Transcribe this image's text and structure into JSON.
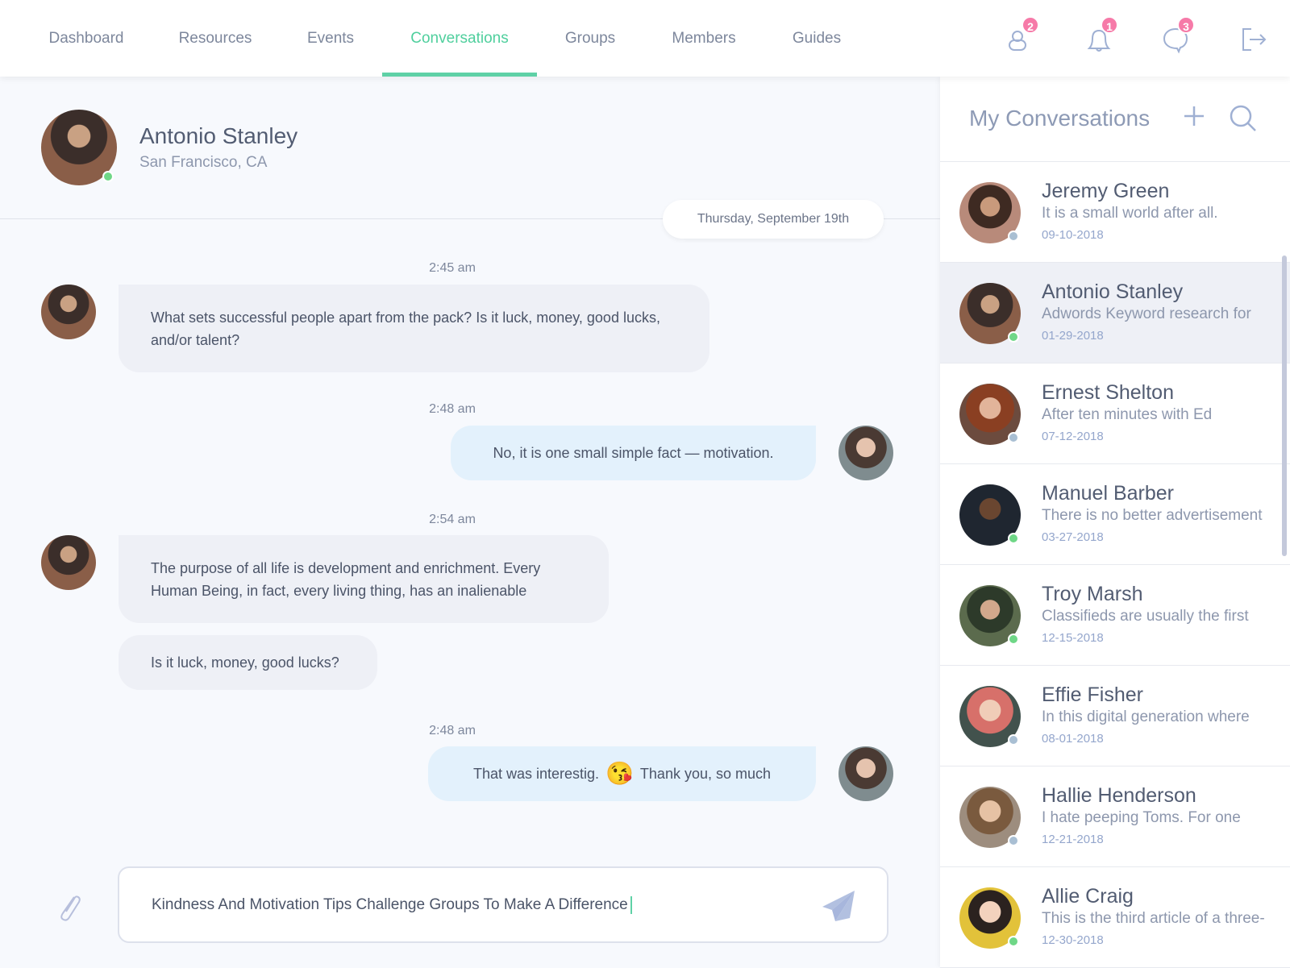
{
  "nav": {
    "tabs": [
      {
        "label": "Dashboard"
      },
      {
        "label": "Resources"
      },
      {
        "label": "Events"
      },
      {
        "label": "Conversations",
        "active": true
      },
      {
        "label": "Groups"
      },
      {
        "label": "Members"
      },
      {
        "label": "Guides"
      }
    ],
    "icons": [
      {
        "icon": "user-icon",
        "badge": "2"
      },
      {
        "icon": "bell-icon",
        "badge": "1"
      },
      {
        "icon": "chat-bubble-icon",
        "badge": "3"
      },
      {
        "icon": "logout-icon"
      }
    ]
  },
  "colors": {
    "accent": "#5fd1a6",
    "badge": "#f67aa8",
    "online": "#6fd787",
    "offline": "#a9bfd3"
  },
  "chat": {
    "contact": {
      "name": "Antonio Stanley",
      "location": "San Francisco, CA",
      "status": "online"
    },
    "date": "Thursday, September 19th",
    "messages": [
      {
        "time": "2:45 am",
        "from": "them",
        "texts": [
          "What sets successful people apart from the pack? Is it luck, money, good lucks, and/or talent?"
        ]
      },
      {
        "time": "2:48 am",
        "from": "me",
        "texts": [
          "No, it is one small simple fact — motivation."
        ]
      },
      {
        "time": "2:54 am",
        "from": "them",
        "texts": [
          "The purpose of all life is development and enrichment. Every Human Being, in fact, every living thing, has an inalienable",
          "Is it luck, money, good lucks?"
        ]
      },
      {
        "time": "2:48 am",
        "from": "me",
        "texts": [
          "That was interestig.",
          "Thank you, so much"
        ],
        "emoji": "😘"
      }
    ],
    "input": {
      "value": "Kindness And Motivation Tips Challenge Groups To Make A Difference"
    }
  },
  "sidebar": {
    "title": "My Conversations",
    "items": [
      {
        "name": "Jeremy Green",
        "preview": "It is a small world after all.",
        "date": "09-10-2018",
        "status": "offline"
      },
      {
        "name": "Antonio Stanley",
        "preview": "Adwords Keyword research for",
        "date": "01-29-2018",
        "status": "online",
        "selected": true
      },
      {
        "name": "Ernest Shelton",
        "preview": "After ten minutes with Ed",
        "date": "07-12-2018",
        "status": "offline"
      },
      {
        "name": "Manuel Barber",
        "preview": "There is no better advertisement",
        "date": "03-27-2018",
        "status": "online"
      },
      {
        "name": "Troy Marsh",
        "preview": "Classifieds are usually the first",
        "date": "12-15-2018",
        "status": "online"
      },
      {
        "name": "Effie Fisher",
        "preview": "In this digital generation where",
        "date": "08-01-2018",
        "status": "offline"
      },
      {
        "name": "Hallie Henderson",
        "preview": "I hate peeping Toms. For one",
        "date": "12-21-2018",
        "status": "offline"
      },
      {
        "name": "Allie Craig",
        "preview": "This is the third article of a three-",
        "date": "12-30-2018",
        "status": "online"
      }
    ]
  }
}
